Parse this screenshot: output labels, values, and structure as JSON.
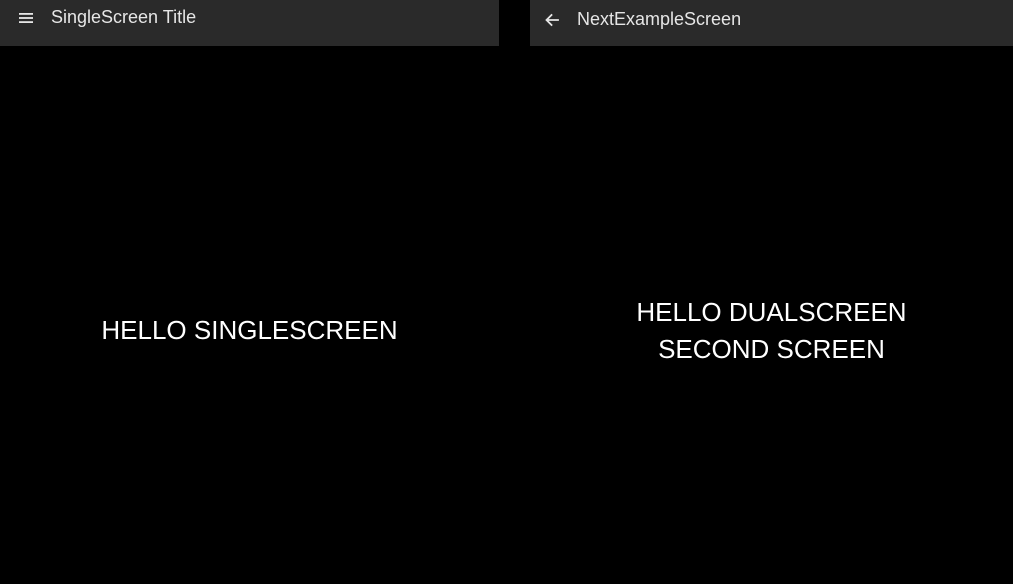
{
  "left_screen": {
    "title": "SingleScreen Title",
    "menu_icon": "hamburger-menu-icon",
    "body_text": "HELLO SINGLESCREEN"
  },
  "right_screen": {
    "title": "NextExampleScreen",
    "back_icon": "back-arrow-icon",
    "body_line_1": "HELLO DUALSCREEN",
    "body_line_2": "SECOND SCREEN"
  },
  "colors": {
    "background": "#000000",
    "appbar": "#2a2a2a",
    "appbar_text": "#e6e6e6",
    "body_text": "#ffffff"
  }
}
